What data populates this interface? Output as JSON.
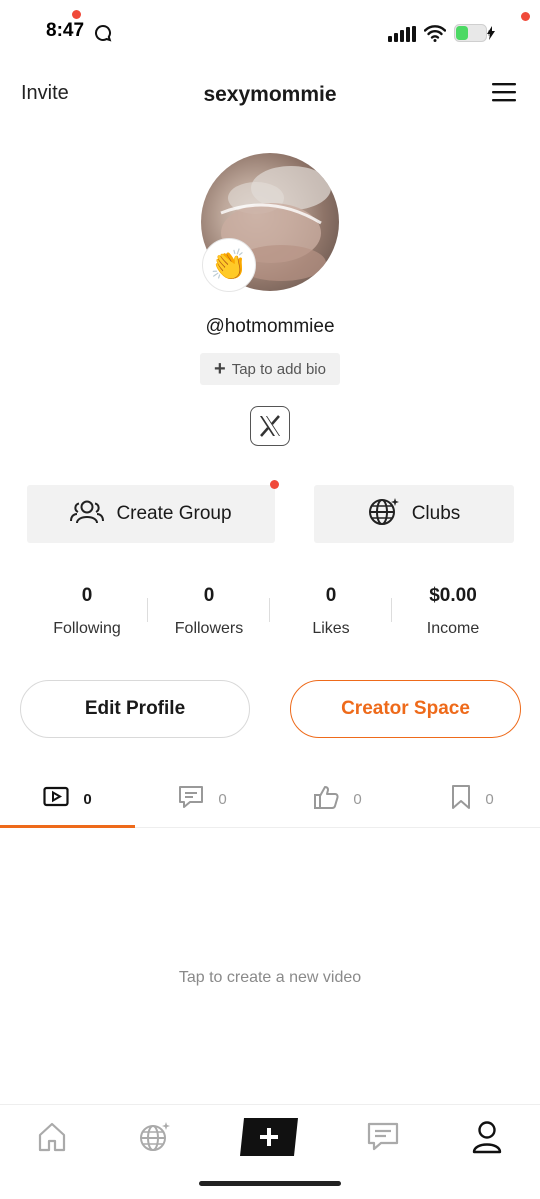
{
  "status_bar": {
    "time": "8:47",
    "chat_icon": "chat-bubble-icon",
    "signal_icon": "cellular-signal-icon",
    "wifi_icon": "wifi-icon",
    "battery_icon": "battery-charging-icon",
    "battery_color": "#4cd964"
  },
  "header": {
    "invite_label": "Invite",
    "title": "sexymommie",
    "menu_icon": "hamburger-menu-icon",
    "badge_color": "#f04a3a"
  },
  "profile": {
    "avatar_badge_emoji": "👏",
    "handle": "@hotmommiee",
    "bio_button": {
      "plus": "+",
      "label": "Tap to add bio"
    },
    "social_icon": "x-logo-icon"
  },
  "actions": {
    "create_group": {
      "label": "Create Group",
      "icon": "group-icon"
    },
    "clubs": {
      "label": "Clubs",
      "icon": "globe-icon"
    }
  },
  "stats": [
    {
      "value": "0",
      "label": "Following"
    },
    {
      "value": "0",
      "label": "Followers"
    },
    {
      "value": "0",
      "label": "Likes"
    },
    {
      "value": "$0.00",
      "label": "Income"
    }
  ],
  "buttons": {
    "edit_profile": "Edit Profile",
    "creator_space": "Creator Space",
    "accent_color": "#ee6a1a"
  },
  "tabs": [
    {
      "icon": "video-icon",
      "count": "0",
      "active": true
    },
    {
      "icon": "comment-icon",
      "count": "0",
      "active": false
    },
    {
      "icon": "thumbs-up-icon",
      "count": "0",
      "active": false
    },
    {
      "icon": "bookmark-icon",
      "count": "0",
      "active": false
    }
  ],
  "empty_state": "Tap to create a new video",
  "bottom_nav": [
    {
      "icon": "home-icon"
    },
    {
      "icon": "explore-globe-icon"
    },
    {
      "icon": "plus-icon"
    },
    {
      "icon": "messages-icon"
    },
    {
      "icon": "profile-icon",
      "active": true
    }
  ]
}
